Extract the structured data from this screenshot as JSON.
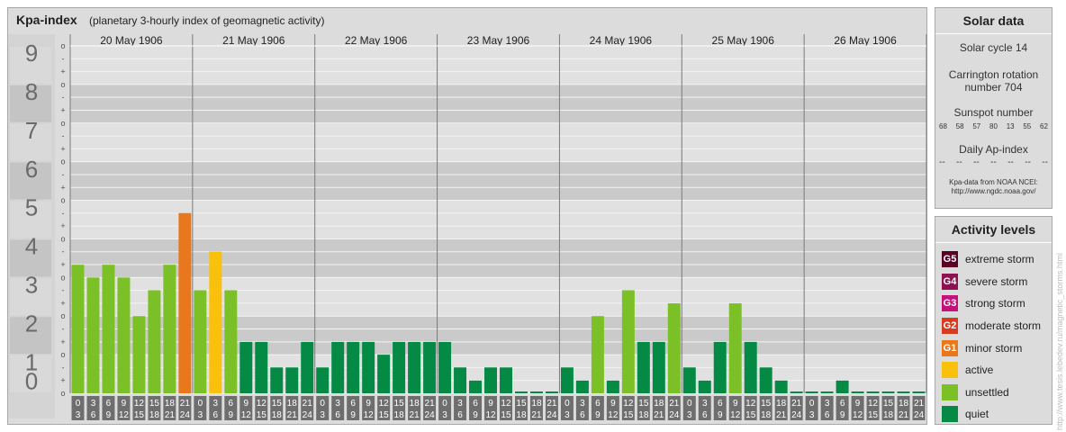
{
  "header": {
    "title": "Kpa-index",
    "subtitle": "(planetary 3-hourly index of geomagnetic activity)"
  },
  "chart_data": {
    "type": "bar",
    "title": "Kpa-index",
    "subtitle": "(planetary 3-hourly index of geomagnetic activity)",
    "ylim": [
      0,
      9
    ],
    "y_ticks": [
      "0",
      "1",
      "2",
      "3",
      "4",
      "5",
      "6",
      "7",
      "8",
      "9"
    ],
    "y_minor_labels": [
      "o",
      "+",
      "-",
      "o",
      "+",
      "-",
      "o",
      "+",
      "-",
      "o",
      "+",
      "-",
      "o",
      "+",
      "-",
      "o",
      "+",
      "-",
      "o",
      "+",
      "-",
      "o",
      "+",
      "-",
      "o",
      "+",
      "-",
      "o"
    ],
    "days": [
      "20 May 1906",
      "21 May 1906",
      "22 May 1906",
      "23 May 1906",
      "24 May 1906",
      "25 May 1906",
      "26 May 1906"
    ],
    "interval_labels": [
      [
        "0",
        "3"
      ],
      [
        "3",
        "6"
      ],
      [
        "6",
        "9"
      ],
      [
        "9",
        "12"
      ],
      [
        "12",
        "15"
      ],
      [
        "15",
        "18"
      ],
      [
        "18",
        "21"
      ],
      [
        "21",
        "24"
      ]
    ],
    "values": [
      [
        3.33,
        3.0,
        3.33,
        3.0,
        2.0,
        2.67,
        3.33,
        4.67
      ],
      [
        2.67,
        3.67,
        2.67,
        1.33,
        1.33,
        0.67,
        0.67,
        1.33
      ],
      [
        0.67,
        1.33,
        1.33,
        1.33,
        1.0,
        1.33,
        1.33,
        1.33
      ],
      [
        1.33,
        0.67,
        0.33,
        0.67,
        0.67,
        0.0,
        0.0,
        0.0
      ],
      [
        0.67,
        0.33,
        2.0,
        0.33,
        2.67,
        1.33,
        1.33,
        2.33
      ],
      [
        0.67,
        0.33,
        1.33,
        2.33,
        1.33,
        0.67,
        0.33,
        0.0
      ],
      [
        0.0,
        0.0,
        0.33,
        0.0,
        0.0,
        0.0,
        0.0,
        0.0
      ]
    ],
    "colors": {
      "quiet": "#058a45",
      "unsettled": "#7ac026",
      "active": "#f9c10b",
      "minor_storm": "#e8781b"
    },
    "grid": true
  },
  "solar": {
    "title": "Solar data",
    "cycle": "Solar cycle 14",
    "carrington_1": "Carrington rotation",
    "carrington_2": "number 704",
    "sunspot_title": "Sunspot number",
    "sunspots": [
      "68",
      "58",
      "57",
      "80",
      "13",
      "55",
      "62"
    ],
    "ap_title": "Daily Ap-index",
    "ap_values": [
      "--",
      "--",
      "--",
      "--",
      "--",
      "--",
      "--"
    ],
    "source_1": "Kpa-data from NOAA NCEI:",
    "source_2": "http://www.ngdc.noaa.gov/"
  },
  "activity": {
    "title": "Activity levels",
    "items": [
      {
        "badge": "G5",
        "label": "extreme storm",
        "color": "#5a0025"
      },
      {
        "badge": "G4",
        "label": "severe storm",
        "color": "#8c1252"
      },
      {
        "badge": "G3",
        "label": "strong storm",
        "color": "#c4127a"
      },
      {
        "badge": "G2",
        "label": "moderate storm",
        "color": "#d63d20"
      },
      {
        "badge": "G1",
        "label": "minor storm",
        "color": "#e8781b"
      },
      {
        "badge": "",
        "label": "active",
        "color": "#f9c10b"
      },
      {
        "badge": "",
        "label": "unsettled",
        "color": "#7ac026"
      },
      {
        "badge": "",
        "label": "quiet",
        "color": "#058a45"
      }
    ]
  },
  "watermark": "http://www.tesis.lebedev.ru/magnetic_storms.html"
}
